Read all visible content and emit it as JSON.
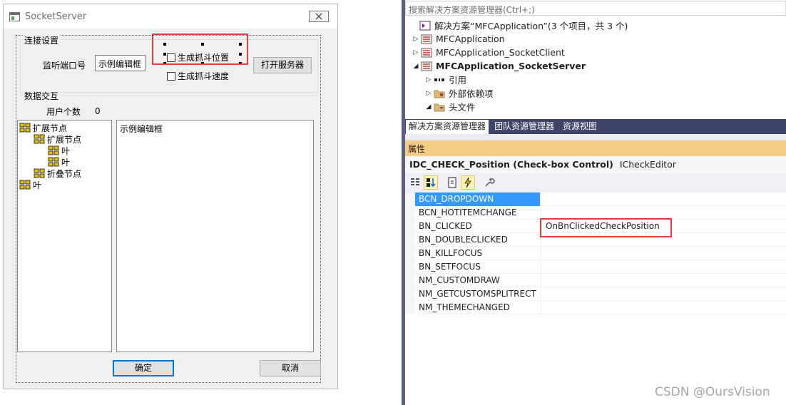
{
  "dialog": {
    "title": "SocketServer",
    "group_connection_label": "连接设置",
    "port_label": "监听端口号",
    "port_edit_value": "示例编辑框",
    "checkbox_position_label": "生成抓斗位置",
    "checkbox_speed_label": "生成抓斗速度",
    "open_server_button": "打开服务器",
    "group_data_label": "数据交互",
    "user_count_label": "用户个数",
    "user_count_value": "0",
    "tree_items": [
      {
        "label": "扩展节点"
      },
      {
        "label": "扩展节点"
      },
      {
        "label": "叶"
      },
      {
        "label": "叶"
      },
      {
        "label": "折叠节点"
      },
      {
        "label": "叶"
      }
    ],
    "edit_area_text": "示例编辑框",
    "ok_button": "确定",
    "cancel_button": "取消"
  },
  "solution_explorer": {
    "search_placeholder": "搜索解决方案资源管理器(Ctrl+;)",
    "solution_label": "解决方案“MFCApplication”(3 个项目，共 3 个)",
    "projects": [
      {
        "label": "MFCApplication"
      },
      {
        "label": "MFCApplication_SocketClient"
      },
      {
        "label": "MFCApplication_SocketServer"
      }
    ],
    "children": [
      {
        "label": "引用"
      },
      {
        "label": "外部依赖项"
      },
      {
        "label": "头文件"
      }
    ],
    "tabs": [
      {
        "label": "解决方案资源管理器"
      },
      {
        "label": "团队资源管理器"
      },
      {
        "label": "资源视图"
      }
    ]
  },
  "properties": {
    "header": "属性",
    "control_id": "IDC_CHECK_Position (Check-box Control)",
    "control_type": "ICheckEditor",
    "events": [
      {
        "name": "BCN_DROPDOWN",
        "value": ""
      },
      {
        "name": "BCN_HOTITEMCHANGE",
        "value": ""
      },
      {
        "name": "BN_CLICKED",
        "value": "OnBnClickedCheckPosition"
      },
      {
        "name": "BN_DOUBLECLICKED",
        "value": ""
      },
      {
        "name": "BN_KILLFOCUS",
        "value": ""
      },
      {
        "name": "BN_SETFOCUS",
        "value": ""
      },
      {
        "name": "NM_CUSTOMDRAW",
        "value": ""
      },
      {
        "name": "NM_GETCUSTOMSPLITRECT",
        "value": ""
      },
      {
        "name": "NM_THEMECHANGED",
        "value": ""
      }
    ]
  },
  "watermark": "CSDN @OursVision",
  "colors": {
    "highlight_red": "#e33e3f",
    "selection_blue": "#3399ff",
    "properties_header": "#f5cc84",
    "tabbar": "#3f4469"
  }
}
